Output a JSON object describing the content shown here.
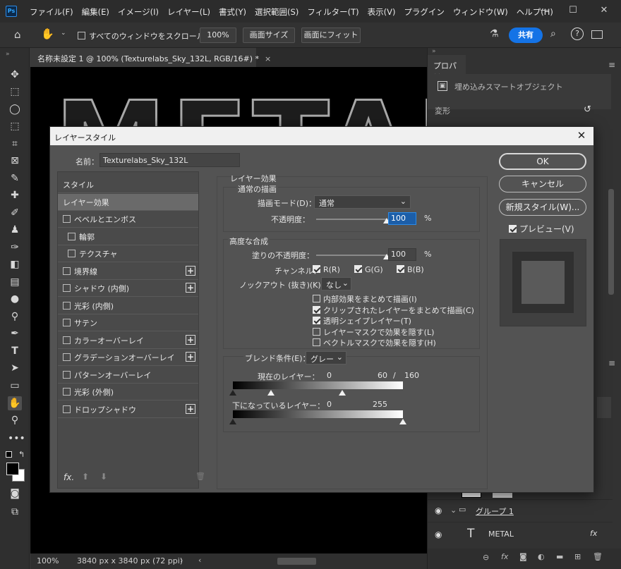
{
  "app": {
    "logo": "Ps"
  },
  "menu": [
    "ファイル(F)",
    "編集(E)",
    "イメージ(I)",
    "レイヤー(L)",
    "書式(Y)",
    "選択範囲(S)",
    "フィルター(T)",
    "表示(V)",
    "プラグイン",
    "ウィンドウ(W)",
    "ヘルプ(H)"
  ],
  "options": {
    "scroll_all": "すべてのウィンドウをスクロール",
    "zoom100": "100%",
    "fit_screen": "画面サイズ",
    "fill_screen": "画面にフィット",
    "share": "共有"
  },
  "document": {
    "tab_title": "名称未設定 1 @ 100% (Texturelabs_Sky_132L, RGB/16#) *",
    "canvas_text": "METAL"
  },
  "status": {
    "zoom": "100%",
    "size": "3840 px x 3840 px (72 ppi)"
  },
  "properties": {
    "tab": "プロパティ",
    "type": "埋め込みスマートオブジェクト",
    "section": "変形"
  },
  "layers": {
    "group": "グループ 1",
    "text_layer": "METAL",
    "fx": "fx"
  },
  "dialog": {
    "title": "レイヤースタイル",
    "name_label": "名前：",
    "name_value": "Texturelabs_Sky_132L",
    "styles": [
      {
        "label": "スタイル",
        "checkbox": false,
        "plus": false,
        "indent": 0
      },
      {
        "label": "レイヤー効果",
        "checkbox": false,
        "plus": false,
        "indent": 0,
        "selected": true
      },
      {
        "label": "ベベルとエンボス",
        "checkbox": true,
        "plus": false,
        "indent": 0
      },
      {
        "label": "輪郭",
        "checkbox": true,
        "plus": false,
        "indent": 1
      },
      {
        "label": "テクスチャ",
        "checkbox": true,
        "plus": false,
        "indent": 1
      },
      {
        "label": "境界線",
        "checkbox": true,
        "plus": true,
        "indent": 0
      },
      {
        "label": "シャドウ (内側)",
        "checkbox": true,
        "plus": true,
        "indent": 0
      },
      {
        "label": "光彩 (内側)",
        "checkbox": true,
        "plus": false,
        "indent": 0
      },
      {
        "label": "サテン",
        "checkbox": true,
        "plus": false,
        "indent": 0
      },
      {
        "label": "カラーオーバーレイ",
        "checkbox": true,
        "plus": true,
        "indent": 0
      },
      {
        "label": "グラデーションオーバーレイ",
        "checkbox": true,
        "plus": true,
        "indent": 0
      },
      {
        "label": "パターンオーバーレイ",
        "checkbox": true,
        "plus": false,
        "indent": 0
      },
      {
        "label": "光彩 (外側)",
        "checkbox": true,
        "plus": false,
        "indent": 0
      },
      {
        "label": "ドロップシャドウ",
        "checkbox": true,
        "plus": true,
        "indent": 0
      }
    ],
    "fx_label": "fx.",
    "effects_title": "レイヤー効果",
    "general_title": "通常の描画",
    "blend_mode_label": "描画モード(D)：",
    "blend_mode_value": "通常",
    "opacity_label": "不透明度：",
    "opacity_value": "100",
    "opacity_level": 1.0,
    "pct": "%",
    "advanced_title": "高度な合成",
    "fill_label": "塗りの不透明度：",
    "fill_value": "100",
    "fill_level": 1.0,
    "channels_label": "チャンネル：",
    "ch_r": "R(R)",
    "ch_g": "G(G)",
    "ch_b": "B(B)",
    "knockout_label": "ノックアウト (抜き)(K)：",
    "knockout_value": "なし",
    "options": [
      {
        "label": "内部効果をまとめて描画(I)",
        "checked": false
      },
      {
        "label": "クリップされたレイヤーをまとめて描画(C)",
        "checked": true
      },
      {
        "label": "透明シェイプレイヤー(T)",
        "checked": true
      },
      {
        "label": "レイヤーマスクで効果を隠す(L)",
        "checked": false
      },
      {
        "label": "ベクトルマスクで効果を隠す(H)",
        "checked": false
      }
    ],
    "blendif_label": "ブレンド条件(E)：",
    "blendif_value": "グレー",
    "this_layer_label": "現在のレイヤー：",
    "this_layer_min": "0",
    "this_layer_mid": "60",
    "this_layer_sep": "/",
    "this_layer_max": "160",
    "under_label": "下になっているレイヤー：",
    "under_min": "0",
    "under_max": "255",
    "ok": "OK",
    "cancel": "キャンセル",
    "new_style": "新規スタイル(W)...",
    "preview": "プレビュー(V)"
  }
}
